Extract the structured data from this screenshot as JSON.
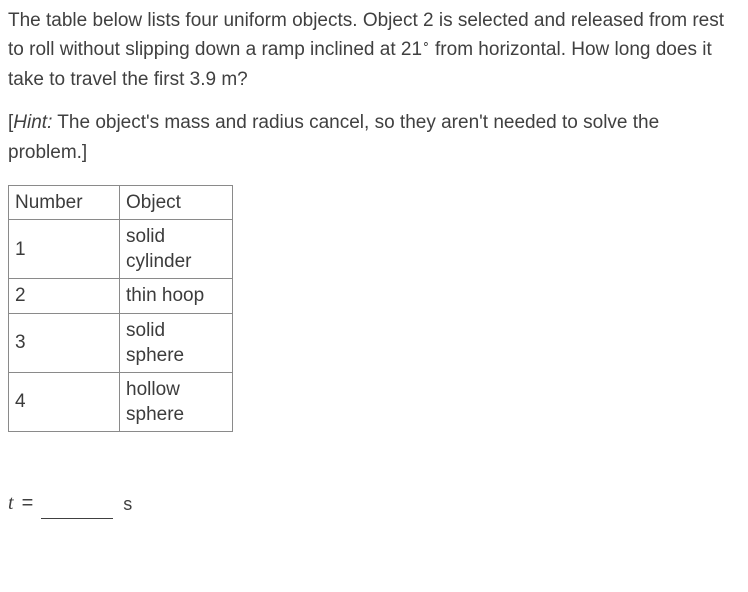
{
  "problem": {
    "text_a": "The table below lists four uniform objects. Object 2 is selected and released from rest to roll without slipping down a ramp inclined at 21",
    "deg": "∘",
    "text_b": " from horizontal. How long does it take to travel the first 3.9 m?"
  },
  "hint": {
    "label": "Hint:",
    "text": " The object's mass and radius cancel, so they aren't needed to solve the problem.]"
  },
  "table": {
    "headers": {
      "number": "Number",
      "object": "Object"
    },
    "rows": [
      {
        "num": "1",
        "obj_l1": "solid",
        "obj_l2": "cylinder"
      },
      {
        "num": "2",
        "obj_l1": "thin hoop",
        "obj_l2": ""
      },
      {
        "num": "3",
        "obj_l1": "solid",
        "obj_l2": "sphere"
      },
      {
        "num": "4",
        "obj_l1": "hollow",
        "obj_l2": "sphere"
      }
    ]
  },
  "answer": {
    "var": "t",
    "eq": "=",
    "unit": "s"
  }
}
